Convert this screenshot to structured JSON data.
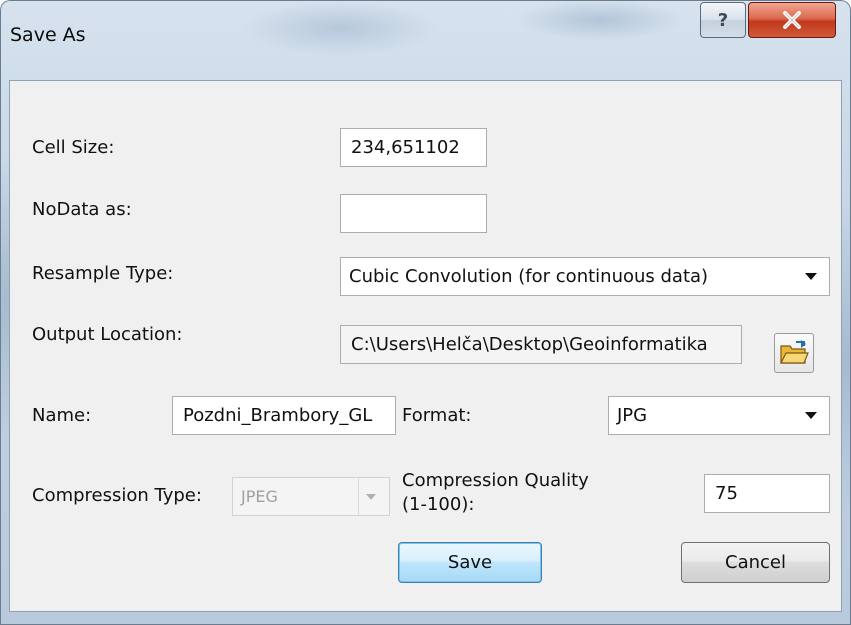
{
  "window": {
    "title": "Save As",
    "help_label": "?",
    "help_icon": "question-icon",
    "close_icon": "close-icon",
    "accent_close": "#c2391c"
  },
  "form": {
    "cell_size": {
      "label": "Cell Size:",
      "value": "234,651102"
    },
    "nodata": {
      "label": "NoData as:",
      "value": ""
    },
    "resample": {
      "label": "Resample Type:",
      "value": "Cubic Convolution (for continuous data)"
    },
    "output_location": {
      "label": "Output Location:",
      "value": "C:\\Users\\Helča\\Desktop\\Geoinformatika",
      "browse_icon": "folder-open-icon"
    },
    "name": {
      "label": "Name:",
      "value": "Pozdni_Brambory_GL"
    },
    "format": {
      "label": "Format:",
      "value": "JPG"
    },
    "compression_type": {
      "label": "Compression Type:",
      "value": "JPEG",
      "disabled": true
    },
    "compression_quality": {
      "label_line1": "Compression Quality",
      "label_line2": "(1-100):",
      "value": "75"
    }
  },
  "buttons": {
    "save": "Save",
    "cancel": "Cancel"
  }
}
